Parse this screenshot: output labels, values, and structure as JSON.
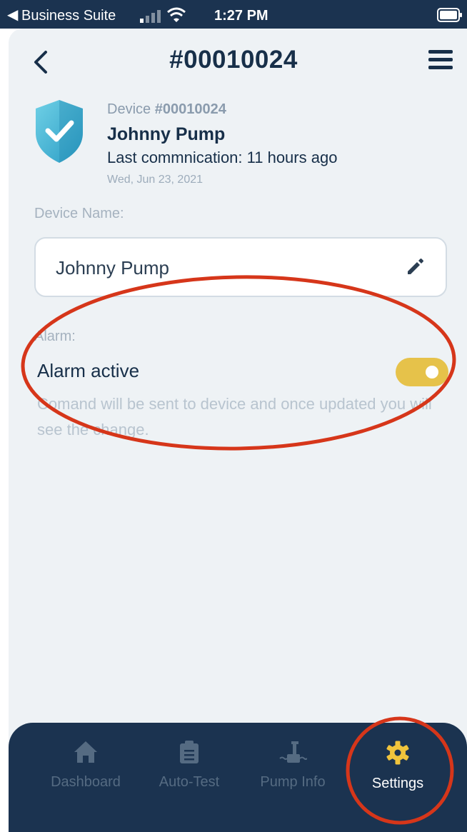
{
  "status_bar": {
    "back_arrow": "◀",
    "carrier": "Business Suite",
    "time": "1:27 PM"
  },
  "header": {
    "title": "#00010024"
  },
  "device": {
    "label_prefix": "Device",
    "id": "#00010024",
    "name": "Johnny Pump",
    "last_communication": "Last commnication: 11 hours ago",
    "date": "Wed, Jun 23, 2021",
    "badge_icon": "shield-check-icon"
  },
  "device_name_field": {
    "label": "Device Name:",
    "value": "Johnny Pump"
  },
  "alarm": {
    "label": "Alarm:",
    "title": "Alarm active",
    "enabled": true,
    "note": "Comand will be sent to device and once updated you will see the change."
  },
  "tabs": [
    {
      "label": "Dashboard",
      "icon": "home-icon",
      "active": false
    },
    {
      "label": "Auto-Test",
      "icon": "clipboard-icon",
      "active": false
    },
    {
      "label": "Pump Info",
      "icon": "pump-icon",
      "active": false
    },
    {
      "label": "Settings",
      "icon": "gear-icon",
      "active": true
    }
  ],
  "colors": {
    "navy": "#172f49",
    "tab_bar": "#1b3350",
    "toggle_on": "#e6c24a",
    "active_icon": "#f0c43c",
    "annotation": "#d6361a"
  }
}
